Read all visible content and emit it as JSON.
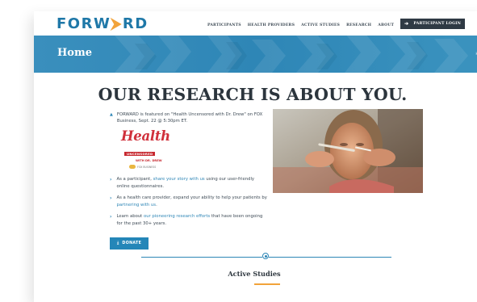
{
  "logo": {
    "part1": "FORW",
    "part2": "⮞",
    "part3": "RD"
  },
  "nav": {
    "items": [
      "PARTICIPANTS",
      "HEALTH PROVIDERS",
      "ACTIVE STUDIES",
      "RESEARCH",
      "ABOUT"
    ],
    "login_label": "PARTICIPANT LOGIN"
  },
  "banner": {
    "title": "Home",
    "breadcrumb": "Ho"
  },
  "headline": "OUR RESEARCH IS ABOUT YOU.",
  "feature": {
    "text": "FORWARD is featured on \"Health Uncensored with Dr. Drew\" on FOX Business, Sept. 22 @ 5:30pm ET.",
    "logo_word": "Health",
    "logo_tag": "UNCENSORED",
    "logo_with": "WITH DR. DREW",
    "logo_fox": "FOX BUSINESS"
  },
  "list": [
    {
      "pre": "As a participant, ",
      "link": "share your story with us",
      "post": " using our user-friendly online questionnaires."
    },
    {
      "pre": "As a health care provider, expand your ability to help your patients by ",
      "link": "partnering with us",
      "post": "."
    },
    {
      "pre": "Learn about ",
      "link": "our pioneering research efforts",
      "post": " that have been ongoing for the past 30+ years."
    }
  ],
  "donate_label": "DONATE",
  "section_title": "Active Studies",
  "colors": {
    "brand_blue": "#2e86b6",
    "accent_orange": "#f2a33a",
    "dark": "#2c353d",
    "login_bg": "#2f3a44"
  },
  "icons": {
    "login": "login-arrow-icon",
    "donate": "download-arrow-icon"
  }
}
